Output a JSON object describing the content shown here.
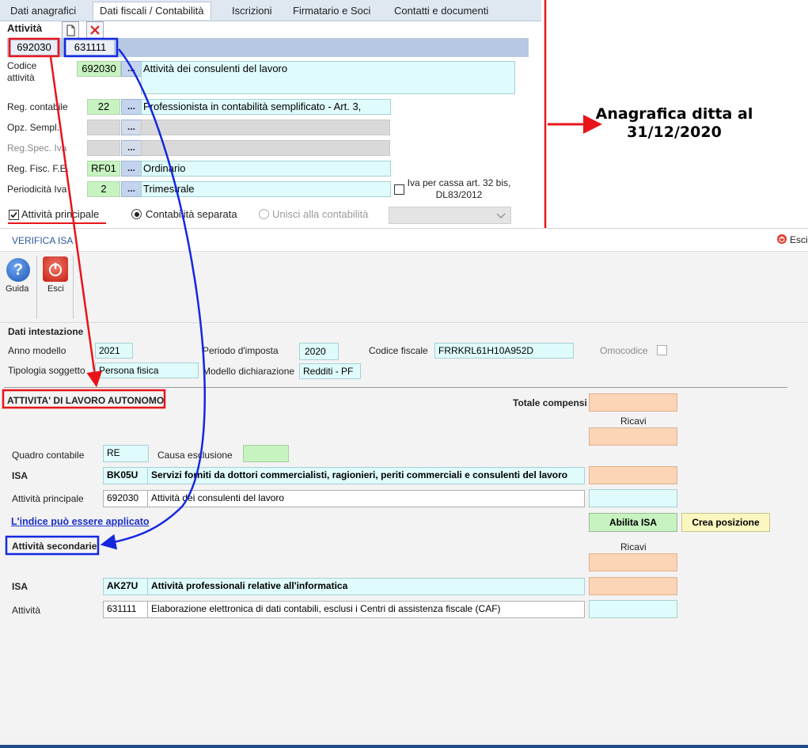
{
  "top_window": {
    "tabs": [
      "Dati anagrafici",
      "Dati fiscali / Contabilità",
      "Iscrizioni",
      "Firmatario e Soci",
      "Contatti e documenti"
    ],
    "section_label": "Attività",
    "activity_codes": [
      "692030",
      "631111"
    ],
    "codice_attivita": {
      "label": "Codice attività",
      "code": "692030",
      "description": "Attività dei consulenti del lavoro"
    },
    "reg_contabile": {
      "label": "Reg. contabile",
      "code": "22",
      "description": "Professionista in contabilità semplificato - Art. 3,"
    },
    "opz_sempl": {
      "label": "Opz. Sempl."
    },
    "reg_spec_iva": {
      "label": "Reg.Spec. Iva"
    },
    "reg_fisc_fe": {
      "label": "Reg. Fisc. F.E.",
      "code": "RF01",
      "description": "Ordinario"
    },
    "periodicita_iva": {
      "label": "Periodicità Iva",
      "code": "2",
      "description": "Trimestrale"
    },
    "iva_per_cassa": {
      "label": "Iva per cassa art. 32 bis, DL83/2012",
      "checked": false
    },
    "attivita_principale": {
      "label": "Attività principale",
      "checked": true
    },
    "contabilita_separata": {
      "label": "Contabilità separata",
      "selected": true
    },
    "unisci_contabilita": {
      "label": "Unisci alla contabilità",
      "selected": false
    },
    "dots_label": "..."
  },
  "annotation": {
    "note": "Anagrafica ditta al 31/12/2020",
    "red_color": "#e8141b",
    "blue_color": "#1428e0"
  },
  "isa_window": {
    "title": "VERIFICA ISA",
    "exit_link": "Esci",
    "toolbar": {
      "guida": "Guida",
      "esci": "Esci"
    },
    "intestazione": {
      "heading": "Dati intestazione",
      "anno_modello_label": "Anno modello",
      "anno_modello": "2021",
      "periodo_label": "Periodo d'imposta",
      "periodo": "2020",
      "cf_label": "Codice fiscale",
      "cf": "FRRKRL61H10A952D",
      "omocodice_label": "Omocodice",
      "tipologia_label": "Tipologia soggetto",
      "tipologia": "Persona fisica",
      "modello_label": "Modello dichiarazione",
      "modello": "Redditi - PF"
    },
    "lavoro_autonomo": {
      "heading": "ATTIVITA' DI LAVORO AUTONOMO",
      "totale_compensi": "Totale compensi",
      "ricavi": "Ricavi",
      "quadro_label": "Quadro contabile",
      "quadro": "RE",
      "causa_label": "Causa esclusione",
      "isa_label": "ISA",
      "isa_code": "BK05U",
      "isa_desc": "Servizi forniti da dottori commercialisti, ragionieri, periti commerciali e consulenti del lavoro",
      "principale_label": "Attività principale",
      "principale_code": "692030",
      "principale_desc": "Attività dei consulenti del lavoro",
      "applicabile_link": "L'indice può essere applicato",
      "abilita_button": "Abilita ISA",
      "crea_button": "Crea posizione"
    },
    "secondarie": {
      "heading": "Attività secondarie",
      "ricavi": "Ricavi",
      "isa_label": "ISA",
      "isa_code": "AK27U",
      "isa_desc": "Attività professionali relative all'informatica",
      "attivita_label": "Attività",
      "attivita_code": "631111",
      "attivita_desc": "Elaborazione elettronica di dati contabili, esclusi i Centri di assistenza fiscale (CAF)"
    }
  }
}
